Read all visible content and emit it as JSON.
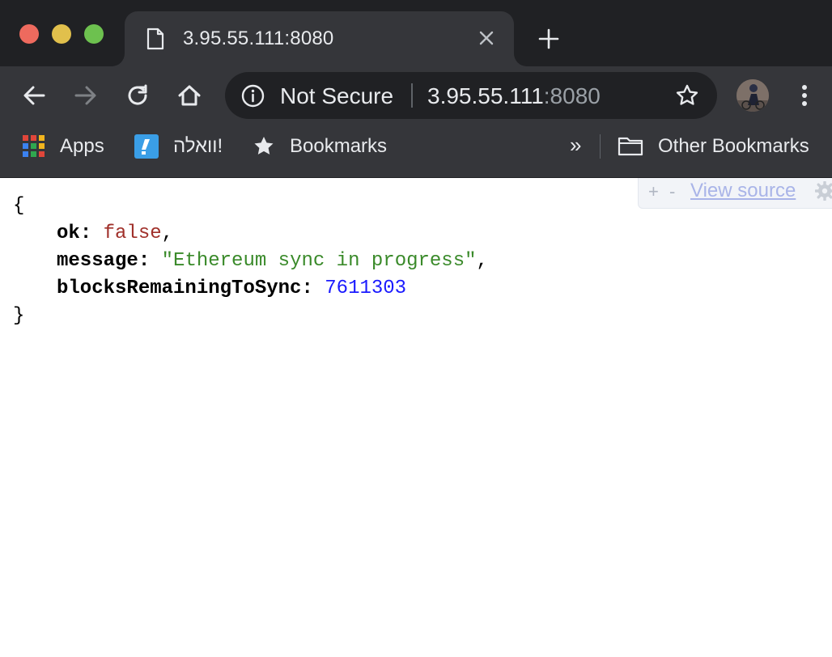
{
  "colors": {
    "chrome_dark": "#202124",
    "chrome_toolbar": "#35363a",
    "text_light": "#e8eaed",
    "json_bool": "#a0302a",
    "json_string": "#3a8a2a",
    "json_number": "#1a1aff"
  },
  "window": {
    "controls": [
      "close",
      "minimize",
      "maximize"
    ]
  },
  "tab": {
    "icon": "page-icon",
    "title": "3.95.55.111:8080",
    "close_icon": "close-icon",
    "new_tab_icon": "plus-icon"
  },
  "toolbar": {
    "back_icon": "back-arrow-icon",
    "forward_icon": "forward-arrow-icon",
    "reload_icon": "reload-icon",
    "home_icon": "home-icon",
    "security_label": "Not Secure",
    "url_host": "3.95.55.111",
    "url_port": ":8080",
    "bookmark_star_icon": "star-icon",
    "menu_icon": "kebab-menu-icon"
  },
  "bookmarks": {
    "items": [
      {
        "label": "Apps",
        "icon": "apps-grid-icon"
      },
      {
        "label": "וואלה!",
        "icon": "walla-icon"
      },
      {
        "label": "Bookmarks",
        "icon": "star-icon"
      }
    ],
    "overflow": "»",
    "other": {
      "label": "Other Bookmarks",
      "icon": "folder-icon"
    }
  },
  "json_viewer": {
    "expand": "+",
    "collapse": "-",
    "view_source": "View source",
    "open_brace": "{",
    "close_brace": "}",
    "fields": [
      {
        "key": "ok",
        "value": "false",
        "type": "boolean",
        "trail": ","
      },
      {
        "key": "message",
        "value": "\"Ethereum sync in progress\"",
        "type": "string",
        "trail": ","
      },
      {
        "key": "blocksRemainingToSync",
        "value": "7611303",
        "type": "number",
        "trail": ""
      }
    ]
  }
}
